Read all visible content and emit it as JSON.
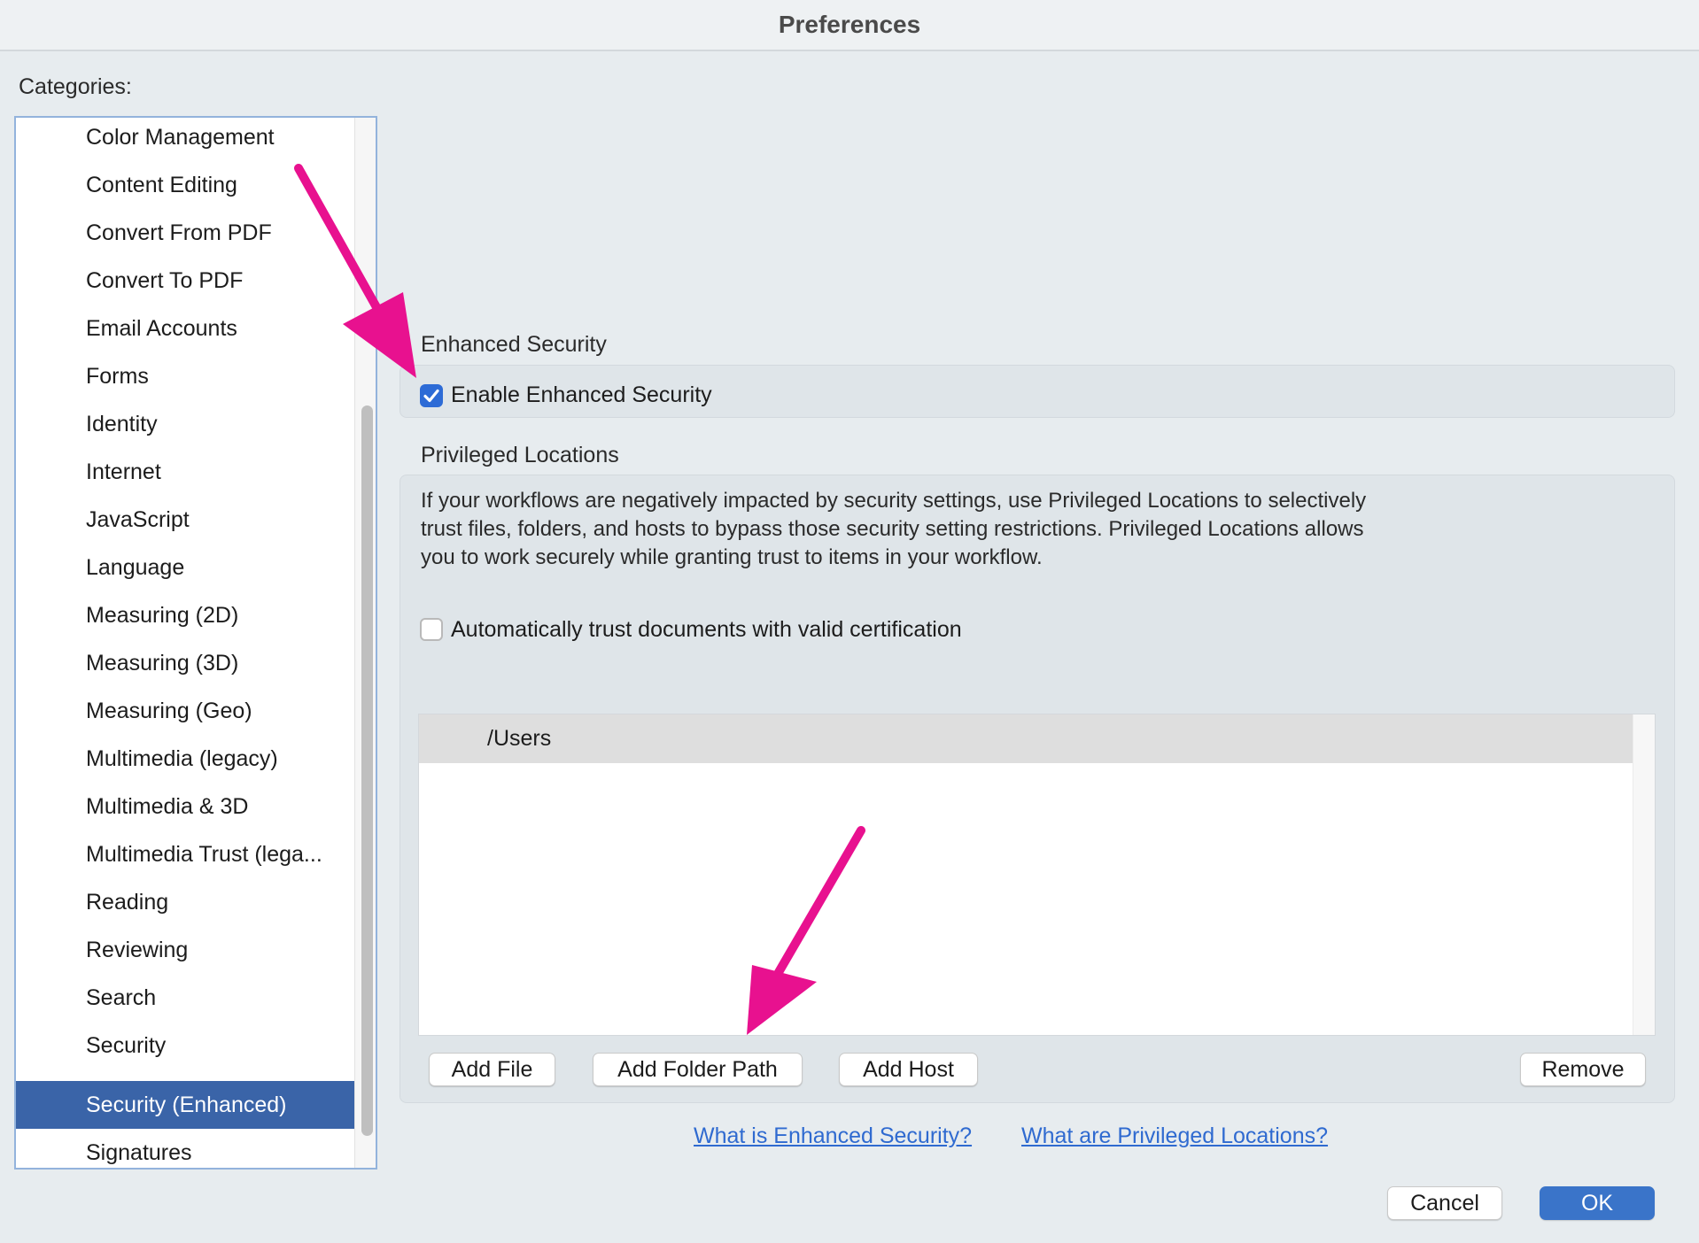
{
  "window": {
    "title": "Preferences"
  },
  "categories_label": "Categories:",
  "sidebar": {
    "items": [
      {
        "label": "Color Management"
      },
      {
        "label": "Content Editing"
      },
      {
        "label": "Convert From PDF"
      },
      {
        "label": "Convert To PDF"
      },
      {
        "label": "Email Accounts"
      },
      {
        "label": "Forms"
      },
      {
        "label": "Identity"
      },
      {
        "label": "Internet"
      },
      {
        "label": "JavaScript"
      },
      {
        "label": "Language"
      },
      {
        "label": "Measuring (2D)"
      },
      {
        "label": "Measuring (3D)"
      },
      {
        "label": "Measuring (Geo)"
      },
      {
        "label": "Multimedia (legacy)"
      },
      {
        "label": "Multimedia & 3D"
      },
      {
        "label": "Multimedia Trust (lega..."
      },
      {
        "label": "Reading"
      },
      {
        "label": "Reviewing"
      },
      {
        "label": "Search"
      },
      {
        "label": "Security"
      },
      {
        "label": "Security (Enhanced)",
        "selected": true
      },
      {
        "label": "Signatures"
      }
    ]
  },
  "enhanced_security": {
    "title": "Enhanced Security",
    "enable_label": "Enable Enhanced Security",
    "enabled": true
  },
  "privileged_locations": {
    "title": "Privileged Locations",
    "description": "If your workflows are negatively impacted by security settings, use Privileged Locations to selectively trust files, folders, and hosts to bypass those security setting restrictions. Privileged Locations allows you to work securely while granting trust to items in your workflow.",
    "auto_trust_label": "Automatically trust documents with valid certification",
    "auto_trust_checked": false,
    "locations": [
      "/Users"
    ],
    "buttons": {
      "add_file": "Add File",
      "add_folder_path": "Add Folder Path",
      "add_host": "Add Host",
      "remove": "Remove"
    }
  },
  "links": {
    "what_is_enhanced": "What is Enhanced Security?",
    "what_are_privileged": "What are Privileged Locations?"
  },
  "footer": {
    "cancel": "Cancel",
    "ok": "OK"
  },
  "colors": {
    "annotation_arrow": "#e8118f",
    "selection": "#3a64a8",
    "accent": "#2d6bd6",
    "link": "#2f6ad0"
  },
  "icons": {
    "checkbox_checked": "checkmark-icon",
    "annotation": "arrow-icon"
  }
}
